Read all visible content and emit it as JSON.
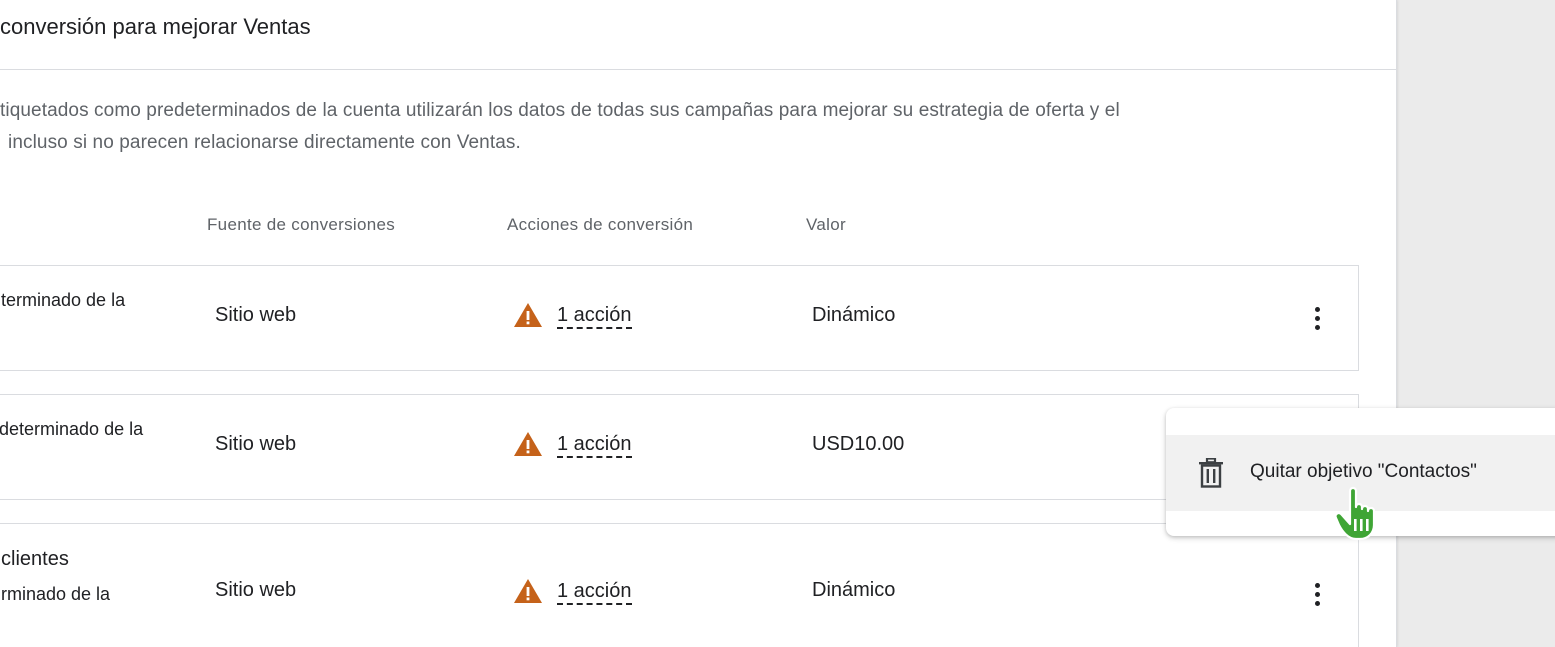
{
  "card": {
    "title": "conversión para mejorar Ventas",
    "description_line1": "tiquetados como predeterminados de la cuenta utilizarán los datos de todas sus campañas para mejorar su estrategia de oferta y el",
    "description_line2": "incluso si no parecen relacionarse directamente con Ventas."
  },
  "table": {
    "headers": {
      "source": "Fuente de conversiones",
      "actions": "Acciones de conversión",
      "value": "Valor"
    },
    "rows": [
      {
        "title": "",
        "name": "terminado de la",
        "source": "Sitio web",
        "actions": "1 acción",
        "value": "Dinámico"
      },
      {
        "title": "",
        "name": "determinado de la",
        "source": "Sitio web",
        "actions": "1 acción",
        "value": "USD10.00"
      },
      {
        "title": "clientes",
        "name": "rminado de la",
        "source": "Sitio web",
        "actions": "1 acción",
        "value": "Dinámico"
      }
    ]
  },
  "context_menu": {
    "remove_goal_label": "Quitar objetivo \"Contactos\""
  },
  "icons": {
    "warning": "warning-triangle-icon",
    "more": "more-vert-icon",
    "trash": "trash-icon",
    "cursor": "hand-pointer-icon"
  },
  "colors": {
    "warning": "#c5621a",
    "cursor": "#3fa535"
  }
}
